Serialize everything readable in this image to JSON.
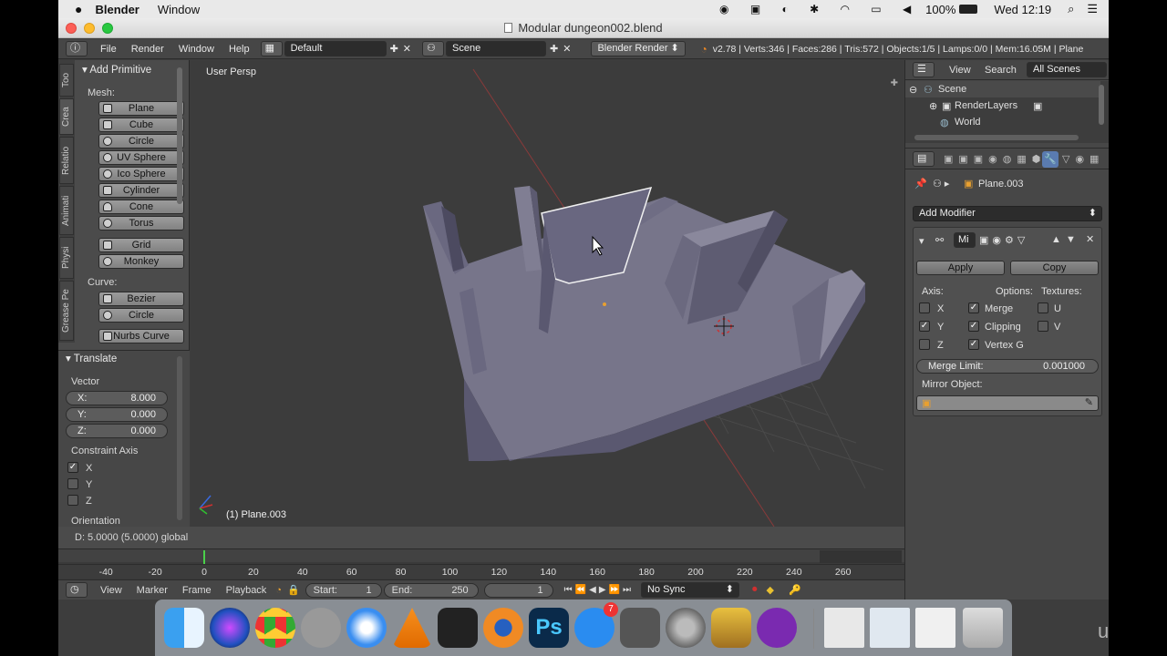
{
  "macos": {
    "app_name": "Blender",
    "menu": [
      "Window"
    ],
    "battery": "100%",
    "clock": "Wed 12:19"
  },
  "window": {
    "title": "Modular dungeon002.blend"
  },
  "info_header": {
    "menus": [
      "File",
      "Render",
      "Window",
      "Help"
    ],
    "layout": "Default",
    "scene": "Scene",
    "engine": "Blender Render",
    "stats": "v2.78 | Verts:346 | Faces:286 | Tris:572 | Objects:1/5 | Lamps:0/0 | Mem:16.05M | Plane"
  },
  "toolshelf": {
    "tabs": [
      "Too",
      "Crea",
      "Relatio",
      "Animati",
      "Physi",
      "Grease Pe"
    ],
    "add_primitive_title": "Add Primitive",
    "mesh_label": "Mesh:",
    "mesh_buttons": [
      "Plane",
      "Cube",
      "Circle",
      "UV Sphere",
      "Ico Sphere",
      "Cylinder",
      "Cone",
      "Torus"
    ],
    "extra_buttons": [
      "Grid",
      "Monkey"
    ],
    "curve_label": "Curve:",
    "curve_buttons": [
      "Bezier",
      "Circle",
      "Nurbs Curve"
    ]
  },
  "translate": {
    "title": "Translate",
    "vector_label": "Vector",
    "x": {
      "label": "X:",
      "value": "8.000"
    },
    "y": {
      "label": "Y:",
      "value": "0.000"
    },
    "z": {
      "label": "Z:",
      "value": "0.000"
    },
    "constraint_label": "Constraint Axis",
    "axes": [
      {
        "label": "X",
        "checked": true
      },
      {
        "label": "Y",
        "checked": false
      },
      {
        "label": "Z",
        "checked": false
      }
    ],
    "orientation_label": "Orientation"
  },
  "viewport": {
    "view_label": "User Persp",
    "object_label": "(1) Plane.003"
  },
  "status_line": "D: 5.0000 (5.0000) global",
  "outliner": {
    "view": "View",
    "search": "Search",
    "filter": "All Scenes",
    "items": [
      "Scene",
      "RenderLayers",
      "World"
    ]
  },
  "properties": {
    "object_name": "Plane.003",
    "add_modifier": "Add Modifier",
    "modifier_name": "Mi",
    "apply": "Apply",
    "copy": "Copy",
    "axis_label": "Axis:",
    "options_label": "Options:",
    "textures_label": "Textures:",
    "axis": [
      {
        "label": "X",
        "checked": false
      },
      {
        "label": "Y",
        "checked": true
      },
      {
        "label": "Z",
        "checked": false
      }
    ],
    "options": [
      {
        "label": "Merge",
        "checked": true
      },
      {
        "label": "Clipping",
        "checked": true
      },
      {
        "label": "Vertex G",
        "checked": true
      }
    ],
    "textures": [
      {
        "label": "U",
        "checked": false
      },
      {
        "label": "V",
        "checked": false
      }
    ],
    "merge_limit_label": "Merge Limit:",
    "merge_limit_value": "0.001000",
    "mirror_object_label": "Mirror Object:"
  },
  "timeline": {
    "ticks": [
      "-40",
      "-20",
      "0",
      "20",
      "40",
      "60",
      "80",
      "100",
      "120",
      "140",
      "160",
      "180",
      "200",
      "220",
      "240",
      "260"
    ],
    "menus": [
      "View",
      "Marker",
      "Frame",
      "Playback"
    ],
    "start_label": "Start:",
    "start": "1",
    "end_label": "End:",
    "end": "250",
    "current": "1",
    "sync": "No Sync"
  },
  "dock": {
    "badge": "7",
    "watermark": "udemy"
  }
}
